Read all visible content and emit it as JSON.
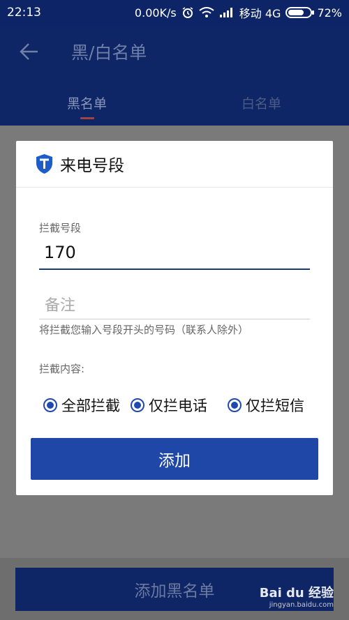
{
  "status_bar": {
    "time": "22:13",
    "network_speed": "0.00K/s",
    "carrier": "移动 4G",
    "battery": "72%",
    "battery_level": 0.72
  },
  "header": {
    "title": "黑/白名单",
    "tabs": [
      {
        "label": "黑名单",
        "active": true
      },
      {
        "label": "白名单",
        "active": false
      }
    ]
  },
  "dialog": {
    "title": "来电号段",
    "prefix_label": "拦截号段",
    "prefix_value": "170",
    "note_placeholder": "备注",
    "hint": "将拦截您输入号段开头的号码（联系人除外）",
    "content_label": "拦截内容:",
    "options": [
      {
        "label": "全部拦截",
        "checked": true
      },
      {
        "label": "仅拦电话",
        "checked": true
      },
      {
        "label": "仅拦短信",
        "checked": true
      }
    ],
    "add_label": "添加"
  },
  "footer": {
    "add_blacklist_label": "添加黑名单"
  },
  "watermark": {
    "text": "Bai du 经验",
    "sub": "jingyan.baidu.com"
  },
  "colors": {
    "primary": "#1e47a7",
    "header": "#0e2566",
    "overlay": "#7a7a7a"
  }
}
